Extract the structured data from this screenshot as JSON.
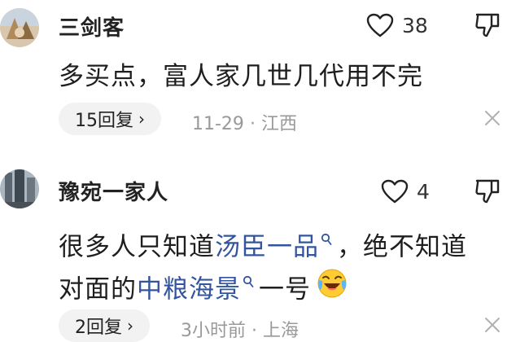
{
  "comments": [
    {
      "username": "三剑客",
      "like_count": "38",
      "text_lines": [
        "多买点，富人家几世几代用不完"
      ],
      "reply_label": "15回复",
      "reply_chevron": "›",
      "time": "11-29",
      "dot": "·",
      "location": "江西"
    },
    {
      "username": "豫宛一家人",
      "like_count": "4",
      "text_segments": {
        "l1_a": "很多人只知道",
        "l1_topic": "汤臣一品",
        "l1_b": "，绝不知道",
        "l2_a": "对面的",
        "l2_topic": "中粮海景",
        "l2_b": "一号"
      },
      "reply_label": "2回复",
      "reply_chevron": "›",
      "time": "3小时前",
      "dot": "·",
      "location": "上海"
    }
  ],
  "icons": {
    "like": "heart-outline-icon",
    "dislike": "thumbs-down-icon",
    "close": "close-icon",
    "topic_search": "search-icon",
    "emoji": "laughing-crying-emoji"
  },
  "colors": {
    "topic_link": "#33549e",
    "meta": "#999999",
    "pill_bg": "#f2f2f2"
  }
}
